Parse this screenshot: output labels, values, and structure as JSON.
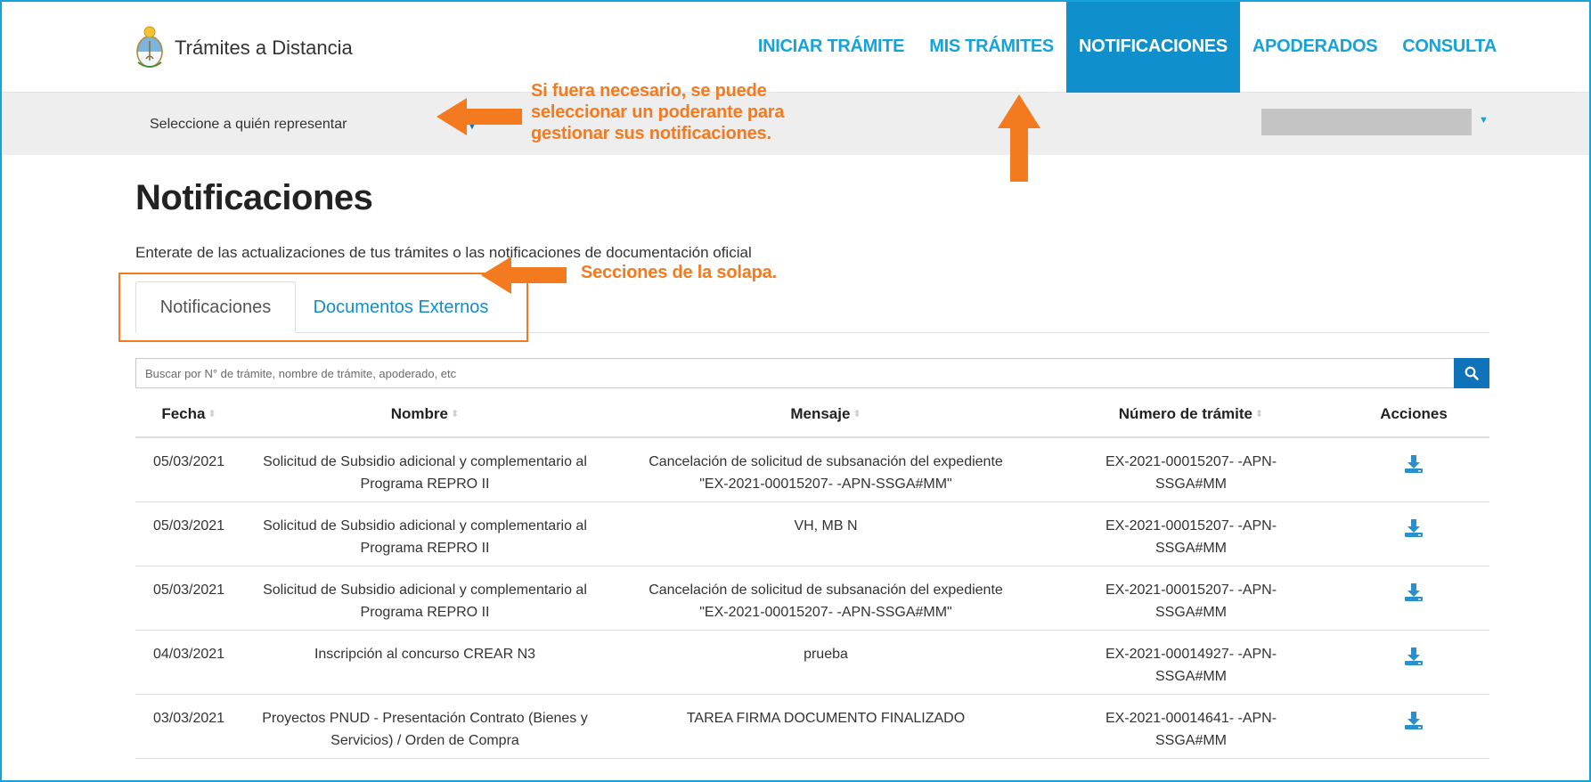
{
  "app": {
    "title": "Trámites a Distancia",
    "accent": "#17a2d8",
    "nav_active_bg": "#0f8fcc",
    "annotation_color": "#f47a20"
  },
  "nav": {
    "items": [
      {
        "label": "INICIAR TRÁMITE",
        "active": false
      },
      {
        "label": "MIS TRÁMITES",
        "active": false
      },
      {
        "label": "NOTIFICACIONES",
        "active": true
      },
      {
        "label": "APODERADOS",
        "active": false
      },
      {
        "label": "CONSULTA",
        "active": false
      }
    ]
  },
  "representation": {
    "label": "Seleccione a quién representar",
    "caret": "▼",
    "user_caret": "▼"
  },
  "annotations": {
    "representation_note": [
      "Si fuera necesario, se puede",
      "seleccionar un poderante para",
      "gestionar sus notificaciones."
    ],
    "tabs_note": "Secciones de la solapa."
  },
  "page": {
    "title": "Notificaciones",
    "subtitle": "Enterate de las actualizaciones de tus trámites o las notificaciones de documentación oficial"
  },
  "tabs": [
    {
      "label": "Notificaciones",
      "active": true
    },
    {
      "label": "Documentos Externos",
      "active": false
    }
  ],
  "search": {
    "placeholder": "Buscar por N° de trámite, nombre de trámite, apoderado, etc",
    "icon": "search-icon"
  },
  "table": {
    "headers": {
      "fecha": "Fecha",
      "nombre": "Nombre",
      "mensaje": "Mensaje",
      "numero": "Número de trámite",
      "acciones": "Acciones"
    },
    "rows": [
      {
        "fecha": "05/03/2021",
        "nombre_1": "Solicitud de Subsidio adicional y complementario al",
        "nombre_2": "Programa REPRO II",
        "mensaje_1": "Cancelación de solicitud de subsanación del expediente",
        "mensaje_2": "\"EX-2021-00015207- -APN-SSGA#MM\"",
        "numero_1": "EX-2021-00015207- -APN-",
        "numero_2": "SSGA#MM"
      },
      {
        "fecha": "05/03/2021",
        "nombre_1": "Solicitud de Subsidio adicional y complementario al",
        "nombre_2": "Programa REPRO II",
        "mensaje_1": "VH, MB N",
        "mensaje_2": "",
        "numero_1": "EX-2021-00015207- -APN-",
        "numero_2": "SSGA#MM"
      },
      {
        "fecha": "05/03/2021",
        "nombre_1": "Solicitud de Subsidio adicional y complementario al",
        "nombre_2": "Programa REPRO II",
        "mensaje_1": "Cancelación de solicitud de subsanación del expediente",
        "mensaje_2": "\"EX-2021-00015207- -APN-SSGA#MM\"",
        "numero_1": "EX-2021-00015207- -APN-",
        "numero_2": "SSGA#MM"
      },
      {
        "fecha": "04/03/2021",
        "nombre_1": "Inscripción al concurso CREAR N3",
        "nombre_2": "",
        "mensaje_1": "prueba",
        "mensaje_2": "",
        "numero_1": "EX-2021-00014927- -APN-",
        "numero_2": "SSGA#MM"
      },
      {
        "fecha": "03/03/2021",
        "nombre_1": "Proyectos PNUD - Presentación Contrato (Bienes y",
        "nombre_2": "Servicios) / Orden de Compra",
        "mensaje_1": "TAREA FIRMA DOCUMENTO FINALIZADO",
        "mensaje_2": "",
        "numero_1": "EX-2021-00014641- -APN-",
        "numero_2": "SSGA#MM"
      }
    ]
  }
}
